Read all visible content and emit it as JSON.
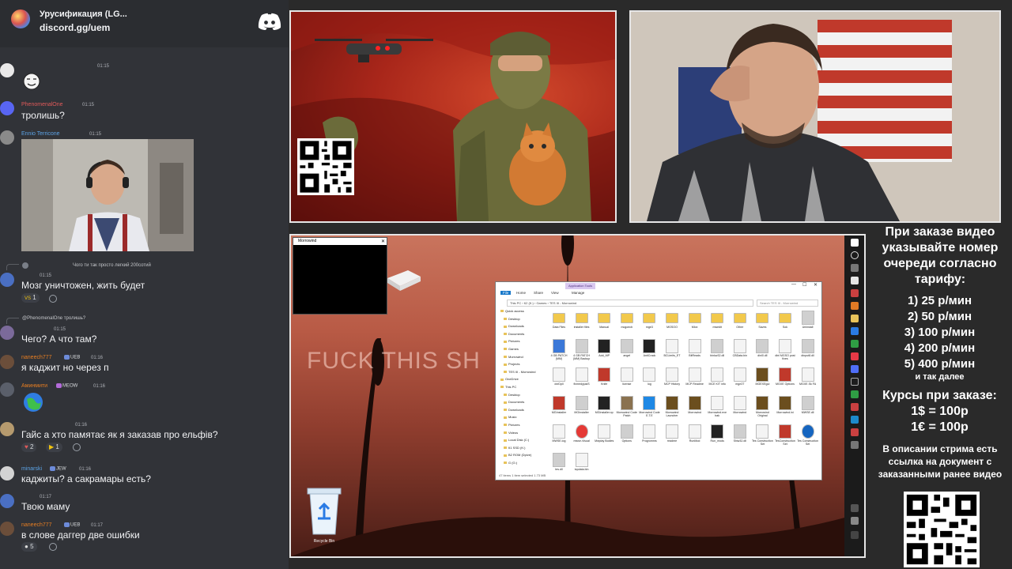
{
  "discord": {
    "server_name": "Урусификация (LG...",
    "invite": "discord.gg/uem"
  },
  "chat": {
    "messages": [
      {
        "id": "m1",
        "username": "",
        "time": "01:15",
        "text": "",
        "has_emoji_only": true
      },
      {
        "id": "m2",
        "username": "PhenomenalOne",
        "time": "01:15",
        "text": "тролишь?"
      },
      {
        "id": "m3",
        "username": "Ennio Terricone",
        "time": "01:15",
        "text": "",
        "has_image": true
      },
      {
        "id": "m4",
        "reply": "Чого ти так просто легкий 200сотий",
        "username": "",
        "time": "01:15",
        "text": "Мозг уничтожен, жить будет",
        "reactions": [
          {
            "emoji": "VS",
            "count": "1"
          }
        ]
      },
      {
        "id": "m5",
        "reply": "@PhenomenalOne тролишь?",
        "username": "",
        "time": "01:15",
        "text": "Чего? А что там?"
      },
      {
        "id": "m6",
        "username": "naneech777",
        "tags": "UEB",
        "time": "01:16",
        "text": "я каджит но через п"
      },
      {
        "id": "m7",
        "username": "Аминмити",
        "tags": "MEOW",
        "time": "01:16",
        "text": "",
        "has_sticker": true
      },
      {
        "id": "m8",
        "username": "",
        "time": "01:16",
        "text": "Гайс а хто памятає як я заказав про ельфів?",
        "reactions": [
          {
            "emoji": "♥",
            "count": "2"
          },
          {
            "emoji": "▶",
            "count": "1"
          }
        ]
      },
      {
        "id": "m9",
        "username": "minarski",
        "tags": "JEW",
        "time": "01:16",
        "text": "каджиты? а сакрамары есть?"
      },
      {
        "id": "m10",
        "username": "",
        "time": "01:17",
        "text": "Твою маму"
      },
      {
        "id": "m11",
        "username": "naneech777",
        "tags": "UEB",
        "time": "01:17",
        "text": "в слове даггер две ошибки",
        "reactions": [
          {
            "emoji": "●",
            "count": "5"
          }
        ]
      }
    ]
  },
  "desktop": {
    "wallpaper_text": "FUCK THIS SH",
    "black_window_title": "Morrowind",
    "recycle_bin_label": "Recycle Bin",
    "explorer": {
      "tools_tab": "Application Tools",
      "ribbon": [
        "File",
        "Home",
        "Share",
        "View",
        "Manage"
      ],
      "address": "This PC › К2 (K:) › Games › TES III - Morrowind",
      "search_placeholder": "Search TES III - Morrowind",
      "nav": [
        "Quick access",
        "Desktop",
        "Downloads",
        "Documents",
        "Pictures",
        "Games",
        "Morrowind",
        "Projects",
        "TES III - Morrowind",
        "OneDrive",
        "This PC",
        "Desktop",
        "Documents",
        "Downloads",
        "Music",
        "Pictures",
        "Videos",
        "Local Disk (C:)",
        "К1 SSD (K:)",
        "В2 ROM (Dрive)",
        "G (G:)"
      ],
      "status": "47 items   1 item selected  1.73 MB",
      "files": [
        {
          "name": "Data Files",
          "kind": "folder"
        },
        {
          "name": "installer files",
          "kind": "folder"
        },
        {
          "name": "Manual",
          "kind": "folder"
        },
        {
          "name": "mcgoecb",
          "kind": "folder"
        },
        {
          "name": "mge3",
          "kind": "folder"
        },
        {
          "name": "MGSOO",
          "kind": "folder"
        },
        {
          "name": "Mlox",
          "kind": "folder"
        },
        {
          "name": "mwedit",
          "kind": "folder"
        },
        {
          "name": "Other",
          "kind": "folder"
        },
        {
          "name": "Saves",
          "kind": "folder"
        },
        {
          "name": "Sok",
          "kind": "folder"
        },
        {
          "name": "Uninstall",
          "kind": "app"
        },
        {
          "name": "4 GB PATCH (MM)",
          "kind": "blue"
        },
        {
          "name": "4 GB PATCH (MM) Backup",
          "kind": "app"
        },
        {
          "name": "Add_MP",
          "kind": "zip"
        },
        {
          "name": "angel",
          "kind": "gear"
        },
        {
          "name": "AntiCrack",
          "kind": "zip"
        },
        {
          "name": "BCLimits_ET",
          "kind": "doc"
        },
        {
          "name": "BitReads",
          "kind": "doc"
        },
        {
          "name": "binkw32.dll",
          "kind": "gear"
        },
        {
          "name": "CBData.bin",
          "kind": "doc"
        },
        {
          "name": "dinl0.dll",
          "kind": "gear"
        },
        {
          "name": "dinl MGSO post fixes",
          "kind": "doc"
        },
        {
          "name": "dinput8.dll",
          "kind": "gear"
        },
        {
          "name": "dxrDpll",
          "kind": "doc"
        },
        {
          "name": "fixmedyjusiS",
          "kind": "doc"
        },
        {
          "name": "Knife",
          "kind": "red"
        },
        {
          "name": "license",
          "kind": "doc"
        },
        {
          "name": "log",
          "kind": "doc"
        },
        {
          "name": "MCP History",
          "kind": "doc"
        },
        {
          "name": "MCP Readme",
          "kind": "doc"
        },
        {
          "name": "MCE KIT info",
          "kind": "doc"
        },
        {
          "name": "mge3T",
          "kind": "doc"
        },
        {
          "name": "MGEXEgui",
          "kind": "game"
        },
        {
          "name": "MGXE Options",
          "kind": "red"
        },
        {
          "name": "MGXE.Sk FA",
          "kind": "doc"
        },
        {
          "name": "MGInstaller",
          "kind": "red"
        },
        {
          "name": "MGInstaller",
          "kind": "gear"
        },
        {
          "name": "MGInstaller.xp",
          "kind": "zip"
        },
        {
          "name": "Morrowind Code Patch",
          "kind": "helmet"
        },
        {
          "name": "Morrowind Code E.T.E",
          "kind": "bolt"
        },
        {
          "name": "Morrowind Launcher",
          "kind": "game"
        },
        {
          "name": "Morrowind",
          "kind": "game"
        },
        {
          "name": "Morrowind.exe bak",
          "kind": "doc"
        },
        {
          "name": "Morrowind",
          "kind": "doc"
        },
        {
          "name": "Morrowind Original",
          "kind": "game"
        },
        {
          "name": "Morrowind.ini",
          "kind": "game"
        },
        {
          "name": "MWSE.dll",
          "kind": "gear"
        },
        {
          "name": "MWSE.log",
          "kind": "doc"
        },
        {
          "name": "mwse-Visual",
          "kind": "chrome"
        },
        {
          "name": "Mwplay Bodies",
          "kind": "doc"
        },
        {
          "name": "Options",
          "kind": "gear"
        },
        {
          "name": "Progromms",
          "kind": "doc"
        },
        {
          "name": "readme",
          "kind": "doc"
        },
        {
          "name": "RunMod",
          "kind": "doc"
        },
        {
          "name": "Run_mods",
          "kind": "zip"
        },
        {
          "name": "Shiw32.dll",
          "kind": "gear"
        },
        {
          "name": "Tes Construction Set",
          "kind": "doc"
        },
        {
          "name": "TesConstruction Set",
          "kind": "red"
        },
        {
          "name": "Tes Construction Set",
          "kind": "help"
        },
        {
          "name": "tes.dll",
          "kind": "gear"
        },
        {
          "name": "topdata.bin",
          "kind": "doc"
        }
      ]
    }
  },
  "info": {
    "heading": "При заказе видео указывайте номер очереди согласно тарифу:",
    "rates": [
      "1) 25 р/мин",
      "2) 50 р/мин",
      "3) 100 р/мин",
      "4) 200 р/мин",
      "5) 400 р/мин"
    ],
    "etc": "и так далее",
    "courses_heading": "Курсы при заказе:",
    "courses": [
      "1$ = 100р",
      "1€ = 100р"
    ],
    "note": "В описании стрима есть ссылка на документ с заказанными ранее видео"
  },
  "colors": {
    "discord_bg": "#313338",
    "discord_header": "#2b2d31",
    "username_orange": "#e67e22",
    "username_blue": "#5ca3e6",
    "username_red": "#e05a5a",
    "stream_bg": "#2a2a2a"
  }
}
